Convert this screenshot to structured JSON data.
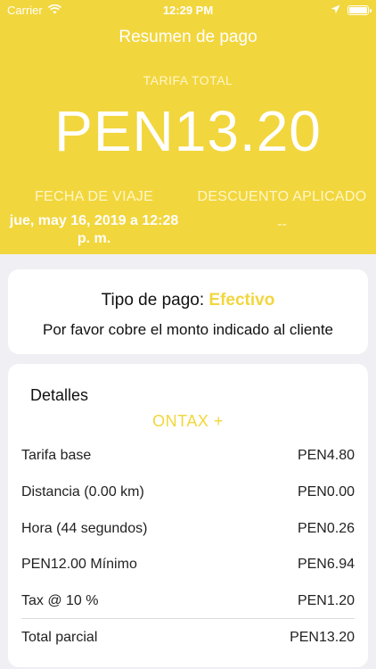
{
  "status_bar": {
    "carrier": "Carrier",
    "time": "12:29 PM"
  },
  "header": {
    "title": "Resumen de pago",
    "fare_label": "TARIFA TOTAL",
    "fare_amount": "PEN13.20",
    "trip_date_label": "FECHA DE VIAJE",
    "trip_date_value": "jue, may 16, 2019 a 12:28 p. m.",
    "discount_label": "DESCUENTO APLICADO",
    "discount_value": "--"
  },
  "payment": {
    "type_label": "Tipo de pago:",
    "type_value": "Efectivo",
    "message": "Por favor cobre el monto indicado al cliente"
  },
  "details": {
    "title": "Detalles",
    "company": "ONTAX +",
    "rows": [
      {
        "label": "Tarifa base",
        "value": "PEN4.80"
      },
      {
        "label": "Distancia (0.00 km)",
        "value": "PEN0.00"
      },
      {
        "label": "Hora (44 segundos)",
        "value": "PEN0.26"
      },
      {
        "label": "PEN12.00 Mínimo",
        "value": "PEN6.94"
      },
      {
        "label": "Tax @ 10 %",
        "value": "PEN1.20"
      }
    ],
    "subtotal": {
      "label": "Total parcial",
      "value": "PEN13.20"
    }
  },
  "colors": {
    "accent": "#f2d63d",
    "background": "#efeff4"
  },
  "icons": [
    "wifi-icon",
    "location-arrow-icon",
    "battery-icon"
  ]
}
